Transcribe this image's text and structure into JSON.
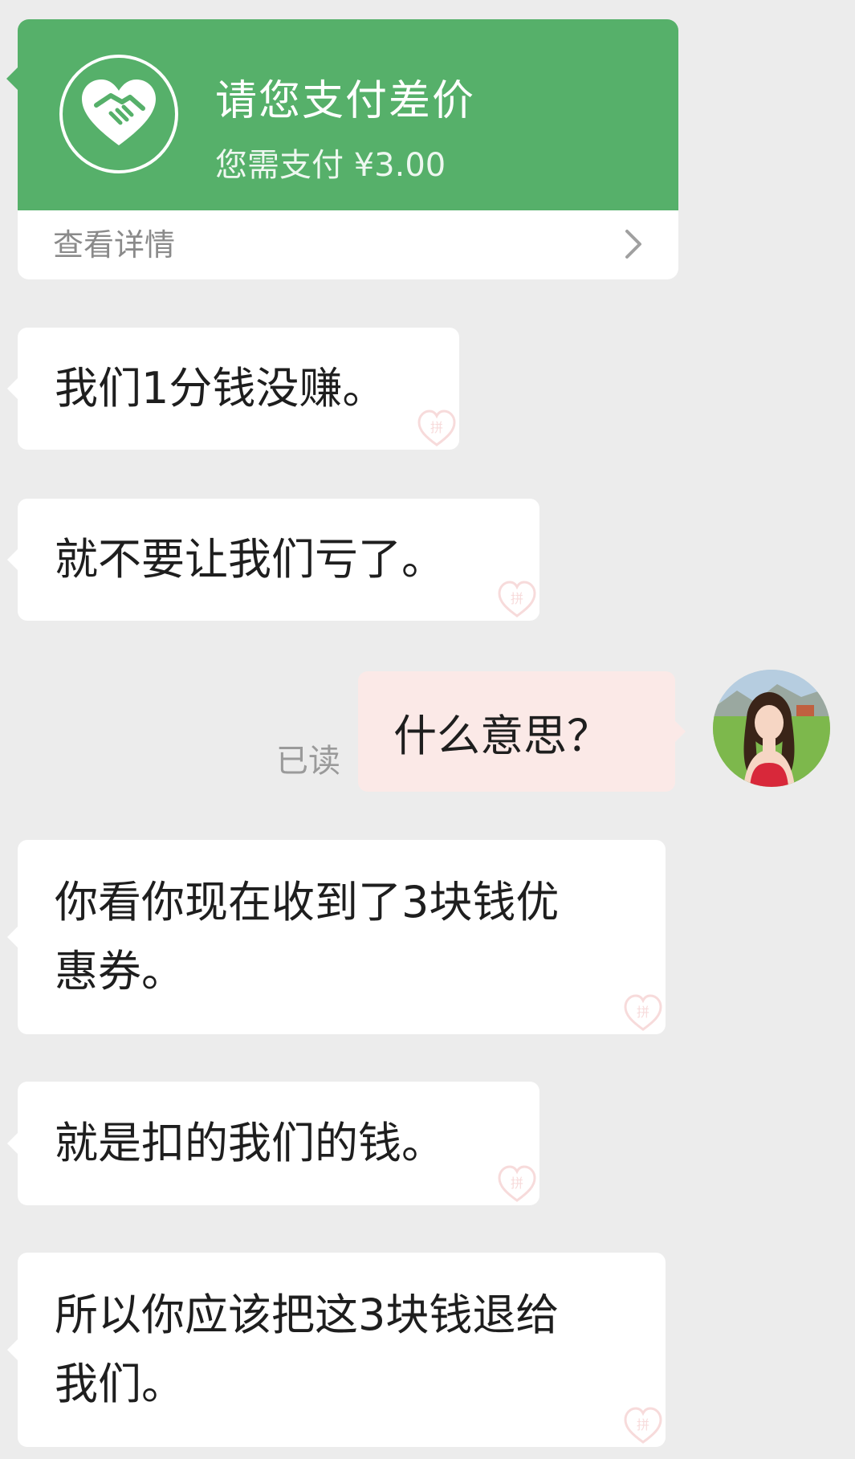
{
  "payment_card": {
    "title": "请您支付差价",
    "subtitle": "您需支付 ¥3.00",
    "detail_link": "查看详情",
    "accent_color": "#56b06a",
    "icon": "heart-handshake-icon"
  },
  "messages": [
    {
      "side": "left",
      "text": "我们1分钱没赚。"
    },
    {
      "side": "left",
      "text": "就不要让我们亏了。"
    },
    {
      "side": "right",
      "text": "什么意思？",
      "status": "已读"
    },
    {
      "side": "left",
      "text": "你看你现在收到了3块钱优\n惠券。"
    },
    {
      "side": "left",
      "text": "就是扣的我们的钱。"
    },
    {
      "side": "left",
      "text": "所以你应该把这3块钱退给\n我们。"
    }
  ],
  "colors": {
    "background": "#ececec",
    "incoming_bubble": "#ffffff",
    "outgoing_bubble": "#fbe9e7"
  }
}
